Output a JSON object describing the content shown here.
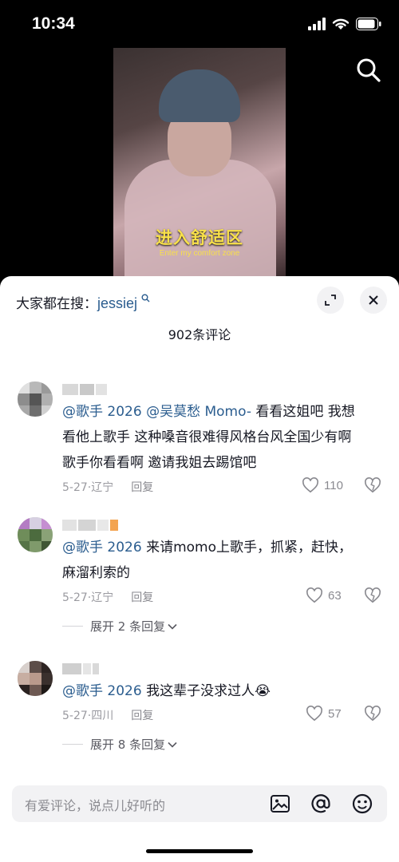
{
  "status_bar": {
    "time": "10:34"
  },
  "video": {
    "caption_cn": "进入舒适区",
    "caption_en": "Enter my comfort zone"
  },
  "sheet": {
    "trending_prefix": "大家都在搜：",
    "trending_keyword": "jessiej",
    "comment_count": "902条评论"
  },
  "comments": [
    {
      "mentions": [
        "@歌手 2026",
        "@吴莫愁 Momo-"
      ],
      "text_line1": "看看这姐吧 我想",
      "text_line2": "看他上歌手 这种嗓音很难得风格台风全国少有啊",
      "text_line3": "歌手你看看啊 邀请我姐去踢馆吧",
      "date": "5-27",
      "location": "辽宁",
      "reply_label": "回复",
      "likes": "110"
    },
    {
      "mentions": [
        "@歌手 2026"
      ],
      "text_line1": "来请momo上歌手，抓紧，赶快，",
      "text_line2": "麻溜利索的",
      "date": "5-27",
      "location": "辽宁",
      "reply_label": "回复",
      "likes": "63",
      "expand_label": "展开 2 条回复"
    },
    {
      "mentions": [
        "@歌手 2026"
      ],
      "text_line1": "我这辈子没求过人",
      "emoji": "😭",
      "date": "5-27",
      "location": "四川",
      "reply_label": "回复",
      "likes": "57",
      "expand_label": "展开 8 条回复"
    }
  ],
  "input": {
    "placeholder": "有爱评论，说点儿好听的"
  },
  "icons": {
    "search": "search-icon",
    "fullscreen": "expand-icon",
    "close": "close-icon",
    "like": "heart-outline-icon",
    "dislike": "broken-heart-icon",
    "image": "image-icon",
    "mention": "at-icon",
    "emoji": "smiley-icon"
  },
  "colors": {
    "mention": "#2b5d8f",
    "caption": "#f8e04a",
    "meta": "#9a9aa0"
  }
}
